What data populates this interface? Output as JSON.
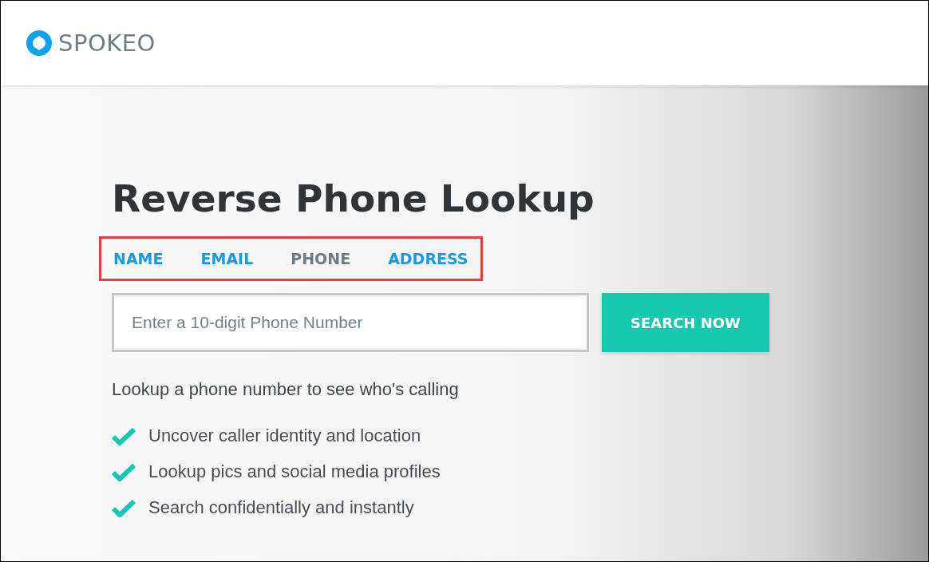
{
  "header": {
    "logo_text": "SPOKEO"
  },
  "hero": {
    "title": "Reverse Phone Lookup",
    "tabs": [
      {
        "label": "NAME",
        "selected": false
      },
      {
        "label": "EMAIL",
        "selected": false
      },
      {
        "label": "PHONE",
        "selected": true
      },
      {
        "label": "ADDRESS",
        "selected": false
      }
    ],
    "search": {
      "placeholder": "Enter a 10-digit Phone Number",
      "button": "SEARCH NOW"
    },
    "subtitle": "Lookup a phone number to see who's calling",
    "features": [
      "Uncover caller identity and location",
      "Lookup pics and social media profiles",
      "Search confidentially and instantly"
    ]
  }
}
